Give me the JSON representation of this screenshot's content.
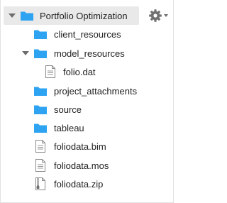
{
  "project": {
    "name": "Portfolio Optimization",
    "expanded": true
  },
  "toolbar": {
    "settings_icon": "gear-icon"
  },
  "items": [
    {
      "label": "client_resources",
      "type": "folder",
      "depth": 1
    },
    {
      "label": "model_resources",
      "type": "folder",
      "depth": 1,
      "expanded": true
    },
    {
      "label": "folio.dat",
      "type": "file",
      "depth": 2
    },
    {
      "label": "project_attachments",
      "type": "folder",
      "depth": 1
    },
    {
      "label": "source",
      "type": "folder",
      "depth": 1
    },
    {
      "label": "tableau",
      "type": "folder",
      "depth": 1
    },
    {
      "label": "foliodata.bim",
      "type": "file",
      "depth": 1
    },
    {
      "label": "foliodata.mos",
      "type": "file",
      "depth": 1
    },
    {
      "label": "foliodata.zip",
      "type": "zip",
      "depth": 1
    }
  ],
  "colors": {
    "folder": "#2ea3f2",
    "selected_row": "#e9e9e9",
    "icon_gray": "#6d6d6d"
  }
}
